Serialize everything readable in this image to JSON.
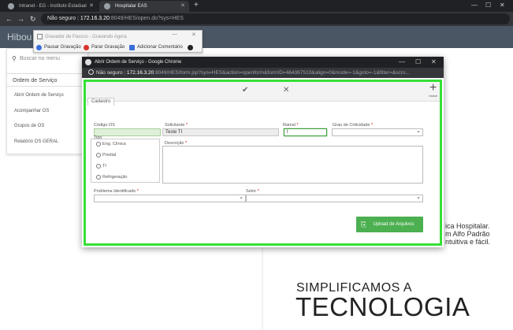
{
  "browser": {
    "tabs": [
      {
        "label": "Intranet - EG - Instituto Estadual"
      },
      {
        "label": "Hospitalar EAS"
      }
    ],
    "url": {
      "security": "Não seguro",
      "host": "172.16.3.20",
      "path": ":8049/HES/open.do?sys=HES"
    }
  },
  "app": {
    "logo": "Hibou",
    "search_placeholder": "Buscar no menu",
    "menu_title": "Ordem de Serviço",
    "menu_items": [
      "Abrir Ordem de Serviço",
      "Acompanhar OS",
      "Grupos de OS",
      "Relatório OS GERAL"
    ],
    "background_text": [
      "ica Hospitalar.",
      "m Alfo Padrão",
      "ntuitiva e fácil."
    ],
    "slogan_line1": "SIMPLIFICAMOS A",
    "slogan_line2": "TECNOLOGIA"
  },
  "recorder": {
    "title": "Gravador de Passos - Gravando Agora",
    "pause": "Pausar Gravação",
    "stop": "Parar Gravação",
    "comment": "Adicionar Comentário"
  },
  "popup": {
    "title": "Abrir Ordem de Serviço - Google Chrome",
    "security": "Não seguro",
    "host": "172.16.3.20",
    "path": ":8049/HES/form.jsp?sys=HES&action=openform&formID=464367510&align=0&mode=-1&goto=-1&filter=&scro...",
    "new_label": "Incluir",
    "form_tab": "Cadastro",
    "fields": {
      "codigo_label": "Código OS",
      "solicitante_label": "Solicitante",
      "solicitante_value": "Teste TI",
      "ramal_label": "Ramal",
      "ramal_value": "I",
      "grau_label": "Grau de Criticidade",
      "tipo_label": "Tipo",
      "tipo_options": [
        "Eng. Clínica",
        "Predial",
        "TI",
        "Refrigeração"
      ],
      "descricao_label": "Descrição",
      "problema_label": "Problema Identificado",
      "setor_label": "Setor"
    },
    "upload_label": "Upload de Arquivos"
  }
}
